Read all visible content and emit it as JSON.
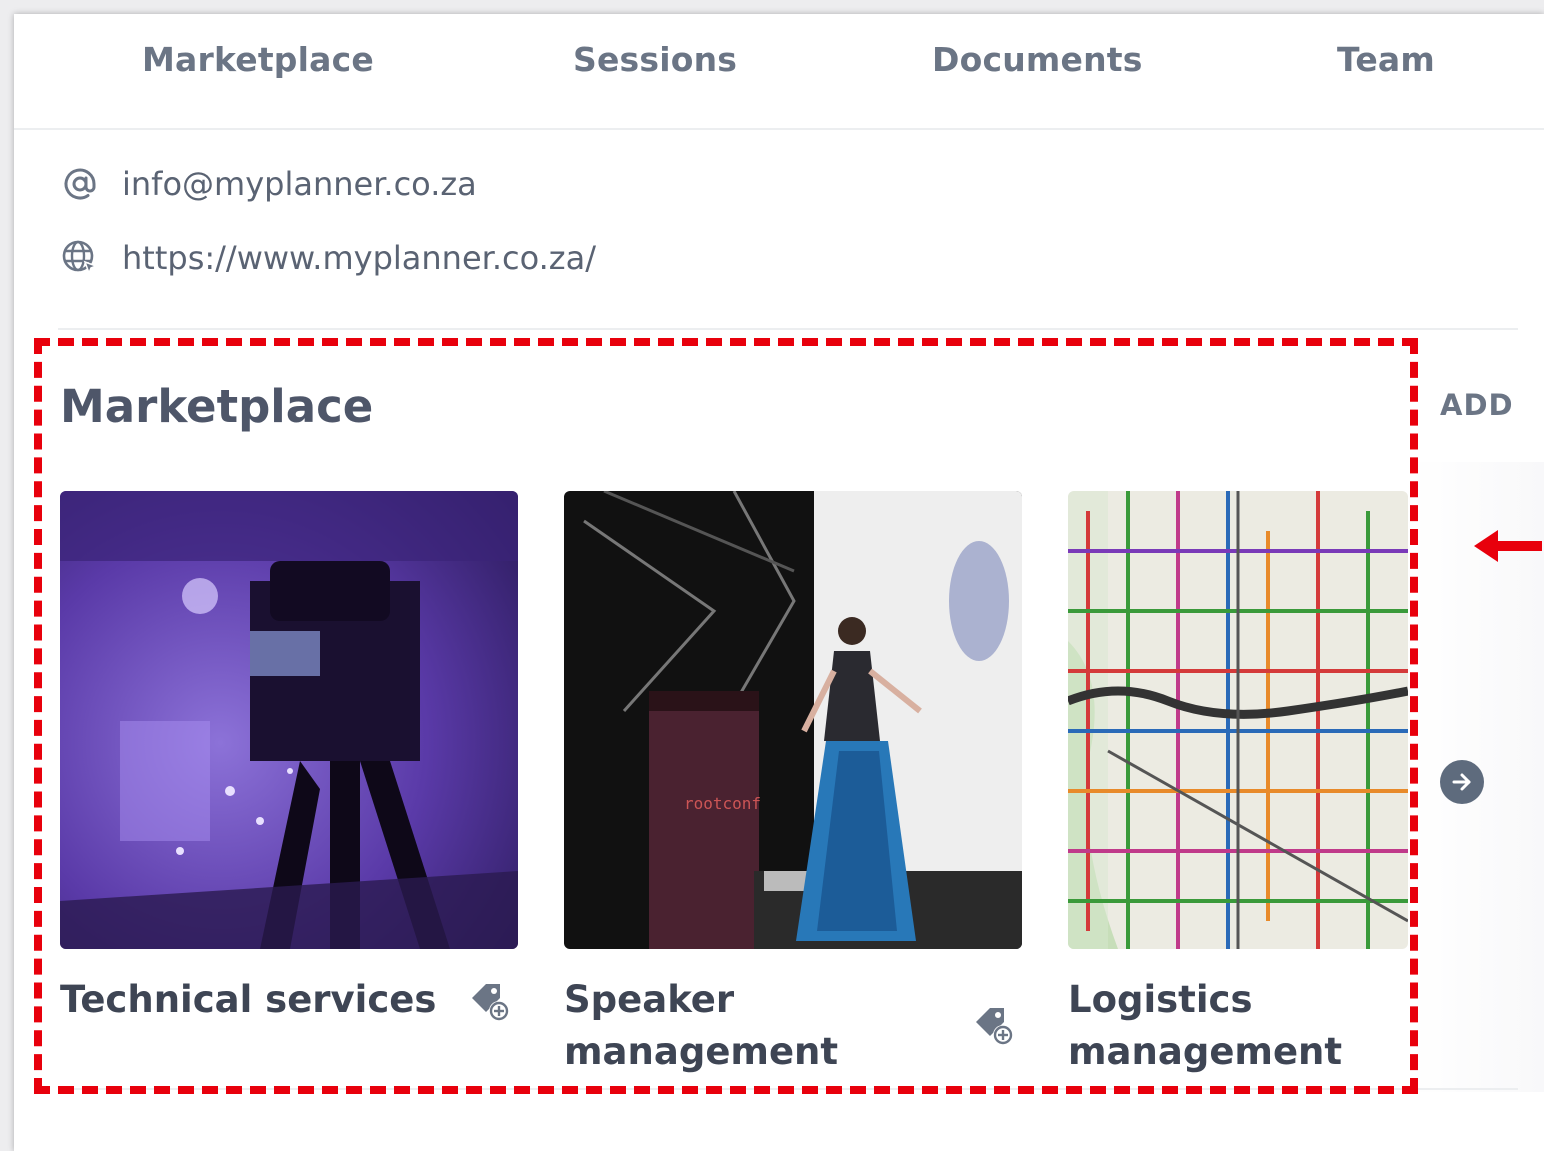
{
  "tabs": [
    {
      "label": "Marketplace"
    },
    {
      "label": "Sessions"
    },
    {
      "label": "Documents"
    },
    {
      "label": "Team"
    }
  ],
  "contact": {
    "email": "info@myplanner.co.za",
    "website": "https://www.myplanner.co.za/",
    "email_icon": "at-icon",
    "website_icon": "globe-icon"
  },
  "marketplace": {
    "title": "Marketplace",
    "add_label": "ADD",
    "cards": [
      {
        "name": "Technical services",
        "image": "camera-stage-photo",
        "icon": "tag-add-icon"
      },
      {
        "name": "Speaker management",
        "image": "speaker-on-stage-photo",
        "icon": "tag-add-icon"
      },
      {
        "name": "Logistics management",
        "image": "transit-map-photo",
        "icon": ""
      }
    ],
    "next_icon": "arrow-right-circle-icon"
  },
  "annotation": {
    "highlight_color": "#e8000c",
    "arrow_icon": "arrow-left-icon"
  },
  "colors": {
    "tab_text": "#6b7585",
    "title_text": "#4e5669",
    "card_text": "#3e4554"
  }
}
